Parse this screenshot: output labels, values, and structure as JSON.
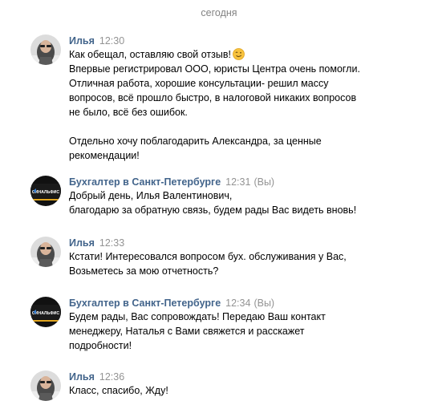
{
  "date_separator": "сегодня",
  "messages": [
    {
      "author": "Илья",
      "time": "12:30",
      "you": "",
      "avatar": "user-photo",
      "paragraphs": [
        [
          "Как обещал, оставляю свой отзыв!",
          "Впервые регистрировал ООО, юристы Центра очень помогли.",
          "Отличная работа, хорошие консультации- решил массу",
          "вопросов, всё прошло быстро, в налоговой никаких вопросов",
          "не было, всё без ошибок."
        ],
        [
          "Отдельно хочу поблагодарить Александра, за ценные",
          "рекомендации!"
        ]
      ],
      "emoji": "wink-smile-emoji"
    },
    {
      "author": "Бухгалтер в Санкт-Петербурге",
      "time": "12:31",
      "you": "(Вы)",
      "avatar": "company-logo",
      "paragraphs": [
        [
          "Добрый день, Илья Валентинович,",
          "благодарю за обратную связь, будем рады Вас видеть вновь!"
        ]
      ]
    },
    {
      "author": "Илья",
      "time": "12:33",
      "you": "",
      "avatar": "user-photo",
      "paragraphs": [
        [
          "Кстати! Интересовался вопросом бух. обслуживания у Вас,",
          "Возьметесь за мою отчетность?"
        ]
      ]
    },
    {
      "author": "Бухгалтер в Санкт-Петербурге",
      "time": "12:34",
      "you": "(Вы)",
      "avatar": "company-logo",
      "paragraphs": [
        [
          "Будем рады, Вас сопровождать! Передаю Ваш контакт",
          "менеджеру, Наталья с Вами свяжется и расскажет",
          "подробности!"
        ]
      ]
    },
    {
      "author": "Илья",
      "time": "12:36",
      "you": "",
      "avatar": "user-photo",
      "paragraphs": [
        [
          "Класс, спасибо, Жду!"
        ]
      ]
    }
  ],
  "logo_text": "СИНАЛЬФИС",
  "colors": {
    "author": "#42648b",
    "meta": "#939393",
    "date": "#828282",
    "text": "#000000"
  }
}
